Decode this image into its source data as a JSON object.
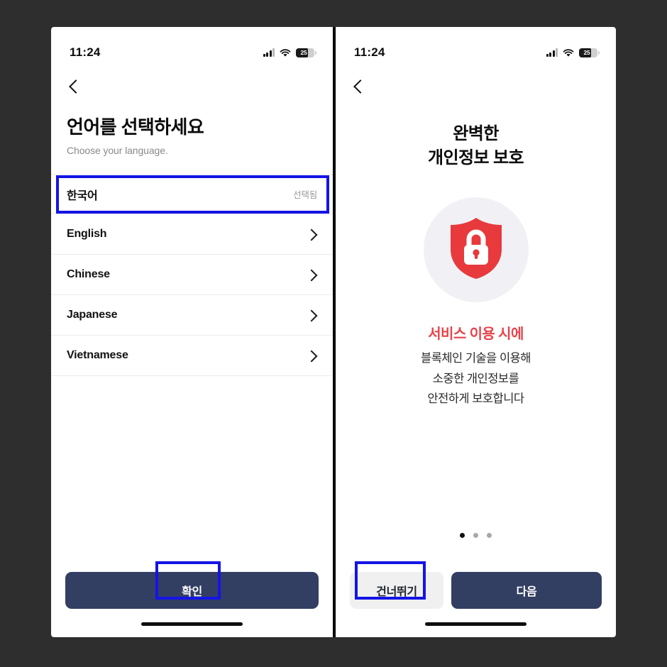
{
  "screen_left": {
    "status_bar": {
      "time": "11:24",
      "signal_icon": "cellular-signal-icon",
      "wifi_icon": "wifi-icon",
      "battery_icon": "battery-icon",
      "battery_level": "25"
    },
    "back_icon": "chevron-left-icon",
    "title": "언어를 선택하세요",
    "subtitle": "Choose your language.",
    "languages": [
      {
        "name": "한국어",
        "state": "선택됨",
        "selected": true
      },
      {
        "name": "English",
        "state": "",
        "selected": false
      },
      {
        "name": "Chinese",
        "state": "",
        "selected": false
      },
      {
        "name": "Japanese",
        "state": "",
        "selected": false
      },
      {
        "name": "Vietnamese",
        "state": "",
        "selected": false
      }
    ],
    "confirm_button": "확인"
  },
  "screen_right": {
    "status_bar": {
      "time": "11:24",
      "signal_icon": "cellular-signal-icon",
      "wifi_icon": "wifi-icon",
      "battery_icon": "battery-icon",
      "battery_level": "25"
    },
    "back_icon": "chevron-left-icon",
    "title_line1": "완벽한",
    "title_line2": "개인정보 보호",
    "illustration_icon": "shield-lock-icon",
    "highlight": "서비스 이용 시에",
    "body_line1": "블록체인 기술을 이용해",
    "body_line2": "소중한 개인정보를",
    "body_line3": "안전하게 보호합니다",
    "pagination": {
      "total": 3,
      "active_index": 0
    },
    "skip_button": "건너뛰기",
    "next_button": "다음"
  },
  "colors": {
    "background": "#2e2e2e",
    "primary_button": "#333e63",
    "annotation": "#1414e6",
    "shield_red": "#e8393c",
    "highlight_red": "#e8434a",
    "circle_bg": "#f1f1f5"
  }
}
